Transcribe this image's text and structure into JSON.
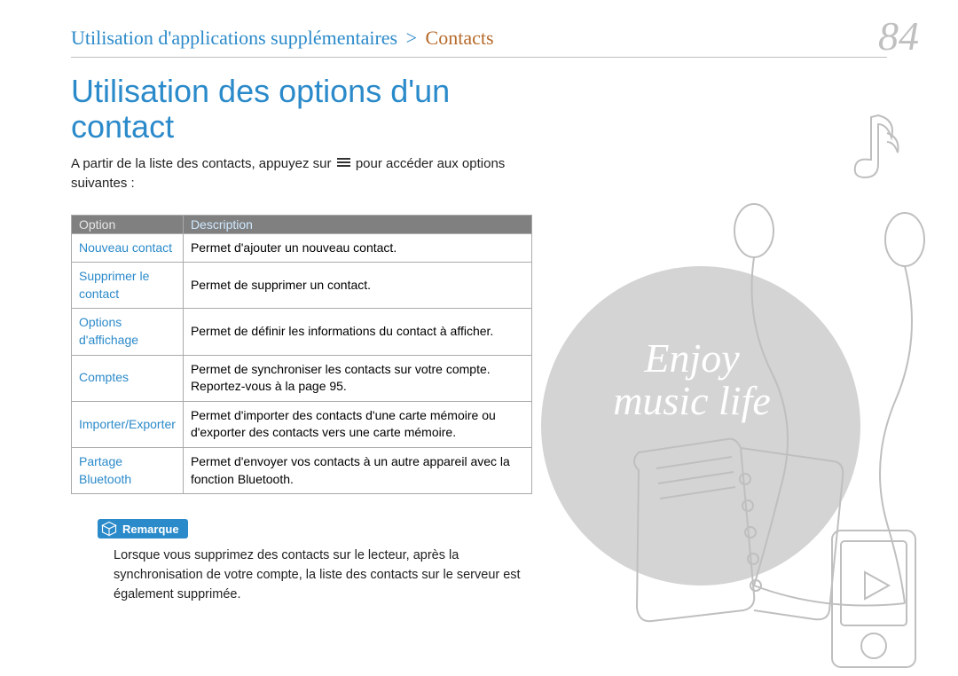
{
  "breadcrumb": {
    "main": "Utilisation d'applications supplémentaires",
    "chevron": ">",
    "sub": "Contacts"
  },
  "page_number": "84",
  "title": "Utilisation des options d'un contact",
  "intro_before": "A partir de la liste des contacts, appuyez sur",
  "intro_after": "pour accéder aux options suivantes :",
  "table": {
    "header_option": "Option",
    "header_description": "Description",
    "rows": [
      {
        "option": "Nouveau contact",
        "desc": "Permet d'ajouter un nouveau contact."
      },
      {
        "option": "Supprimer le contact",
        "desc": "Permet de supprimer un contact."
      },
      {
        "option": "Options d'affichage",
        "desc": "Permet de définir les informations du contact à afficher."
      },
      {
        "option": "Comptes",
        "desc": "Permet de synchroniser les contacts sur votre compte. Reportez-vous à la page 95."
      },
      {
        "option": "Importer/Exporter",
        "desc": "Permet d'importer des contacts d'une carte mémoire ou d'exporter des contacts vers une carte mémoire."
      },
      {
        "option": "Partage Bluetooth",
        "desc": "Permet d'envoyer vos contacts à un autre appareil avec la fonction Bluetooth."
      }
    ]
  },
  "note": {
    "label": "Remarque",
    "text": "Lorsque vous supprimez des contacts sur le lecteur, après la synchronisation de votre compte, la liste des contacts sur le serveur est également supprimée."
  },
  "art_text": {
    "line1": "Enjoy",
    "line2": "music life"
  },
  "chart_data": {
    "type": "table",
    "title": "Utilisation des options d'un contact",
    "columns": [
      "Option",
      "Description"
    ],
    "rows": [
      [
        "Nouveau contact",
        "Permet d'ajouter un nouveau contact."
      ],
      [
        "Supprimer le contact",
        "Permet de supprimer un contact."
      ],
      [
        "Options d'affichage",
        "Permet de définir les informations du contact à afficher."
      ],
      [
        "Comptes",
        "Permet de synchroniser les contacts sur votre compte. Reportez-vous à la page 95."
      ],
      [
        "Importer/Exporter",
        "Permet d'importer des contacts d'une carte mémoire ou d'exporter des contacts vers une carte mémoire."
      ],
      [
        "Partage Bluetooth",
        "Permet d'envoyer vos contacts à un autre appareil avec la fonction Bluetooth."
      ]
    ]
  }
}
